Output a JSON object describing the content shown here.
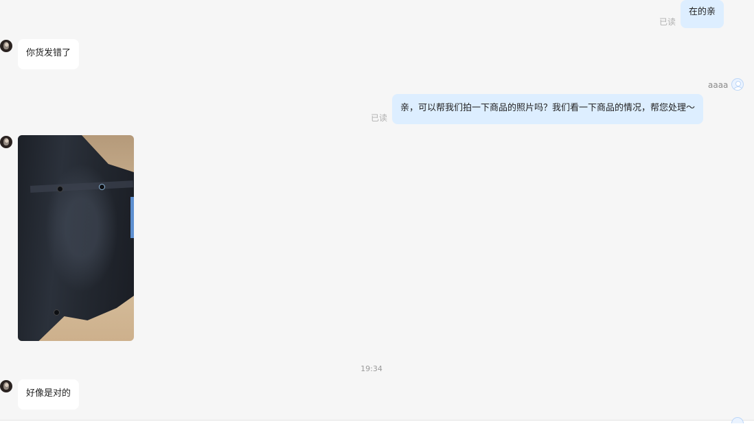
{
  "messages": {
    "m1": {
      "text": "在的亲",
      "read": "已读"
    },
    "m2": {
      "text": "你货发错了"
    },
    "m3": {
      "agent": "aaaa",
      "text": "亲，可以帮我们拍一下商品的照片吗？我们看一下商品的情况，帮您处理～",
      "read": "已读"
    },
    "m4": {
      "image": "black-shirt-photo"
    },
    "time": "19:34",
    "m5": {
      "text": "好像是对的"
    }
  },
  "colors": {
    "background": "#f6f6f6",
    "incoming_bubble": "#ffffff",
    "outgoing_bubble": "#ddeeff",
    "read_text": "#b0b0b0"
  }
}
